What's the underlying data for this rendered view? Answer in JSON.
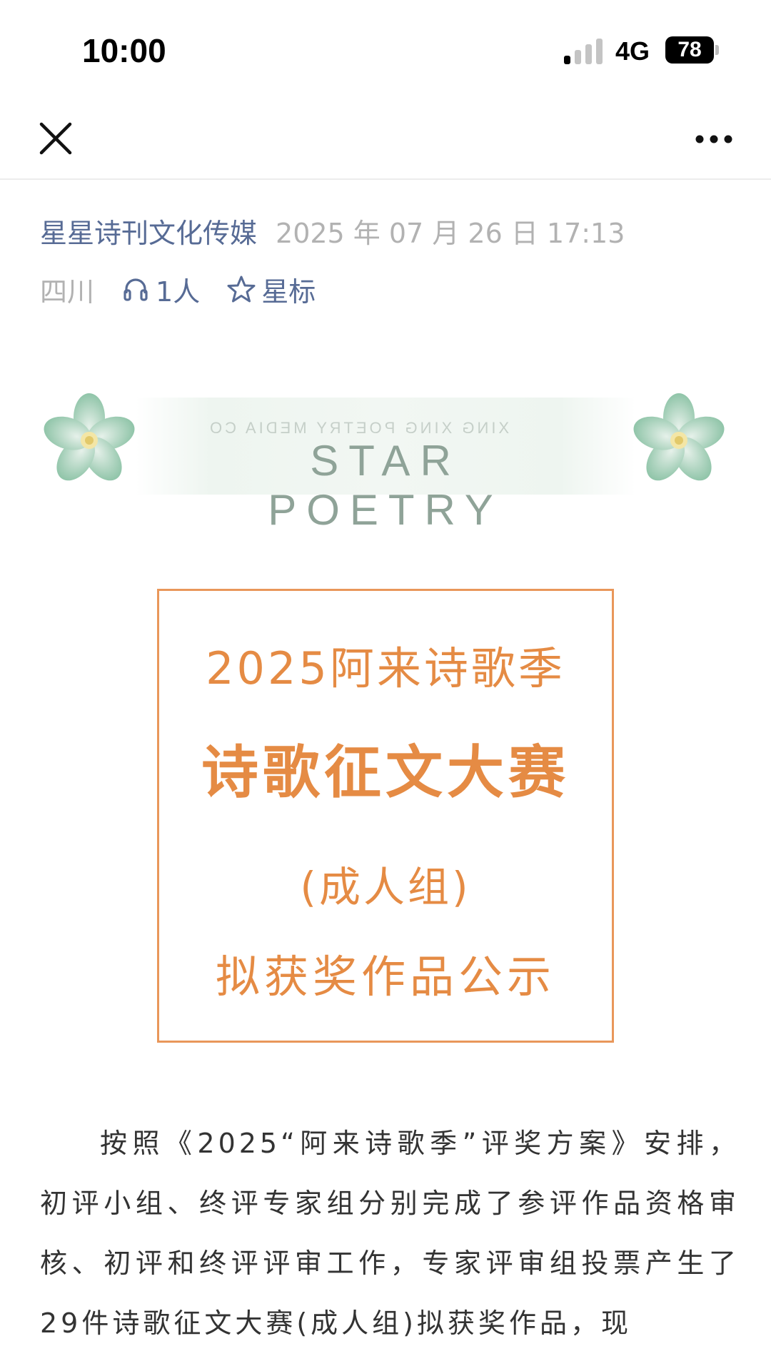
{
  "status": {
    "time": "10:00",
    "network": "4G",
    "battery": "78"
  },
  "nav": {
    "close_icon": "close-icon",
    "more_icon": "more-icon"
  },
  "meta": {
    "author": "星星诗刊文化传媒",
    "date": "2025 年 07 月 26 日 17:13",
    "region": "四川",
    "listen_count": "1人",
    "star_label": "星标"
  },
  "banner": {
    "text": "STAR POETRY",
    "mirror_text": "XING XING POETRY MEDIA CO"
  },
  "title_box": {
    "line1": "2025阿来诗歌季",
    "line2": "诗歌征文大赛",
    "line3": "(成人组)",
    "line4": "拟获奖作品公示"
  },
  "body": {
    "paragraph": "按照《2025“阿来诗歌季”评奖方案》安排，初评小组、终评专家组分别完成了参评作品资格审核、初评和终评评审工作，专家评审组投票产生了29件诗歌征文大赛(成人组)拟获奖作品，现"
  },
  "colors": {
    "link": "#576b95",
    "muted": "#b2b2b2",
    "accent": "#e58b44"
  }
}
